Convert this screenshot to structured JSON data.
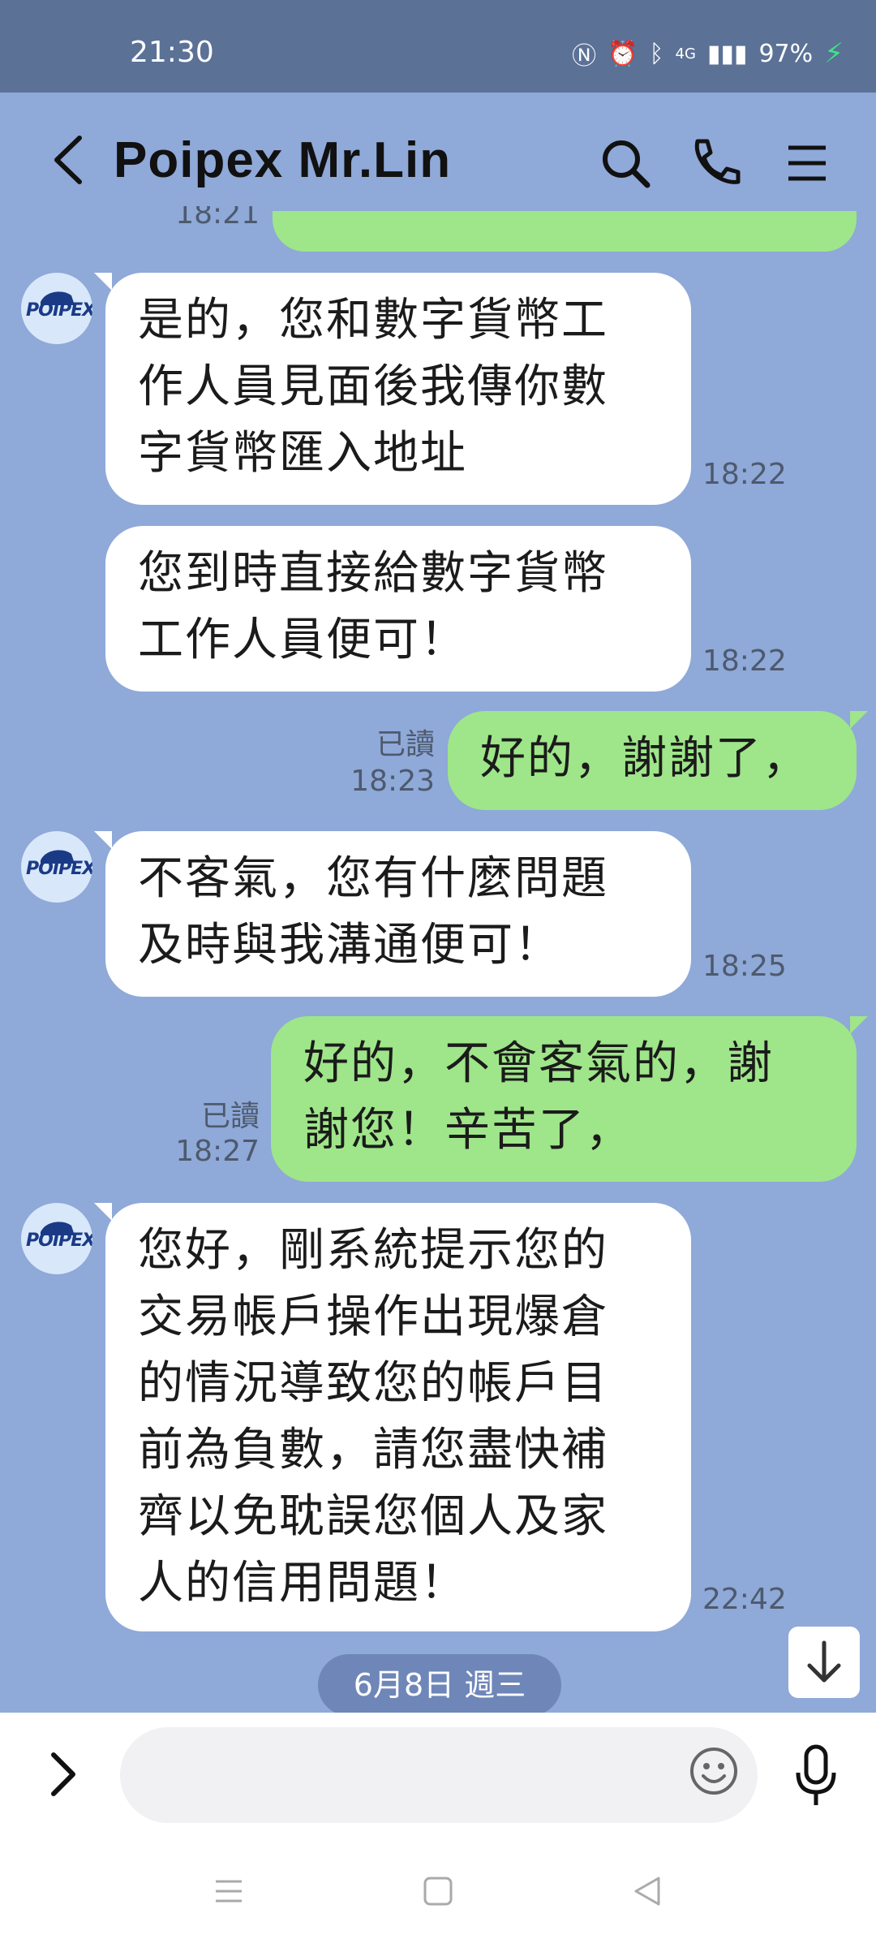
{
  "status": {
    "time": "21:30",
    "signal": "4G",
    "battery": "97%"
  },
  "header": {
    "title": "Poipex  Mr.Lin"
  },
  "avatar_label": "POIPEX",
  "partial_time": "18:21",
  "messages": [
    {
      "side": "left",
      "text": "是的，您和數字貨幣工作人員見面後我傳你數字貨幣匯入地址",
      "lines": [
        "是的，您和數字貨幣工",
        "作人員見面後我傳你數",
        "字貨幣匯入地址"
      ],
      "time": "18:22"
    },
    {
      "side": "left",
      "lines": [
        "您到時直接給數字貨幣",
        "工作人員便可！"
      ],
      "time": "18:22"
    },
    {
      "side": "right",
      "lines": [
        "好的，謝謝了，"
      ],
      "read": "已讀",
      "time": "18:23"
    },
    {
      "side": "left",
      "lines": [
        "不客氣，您有什麼問題",
        "及時與我溝通便可！"
      ],
      "time": "18:25"
    },
    {
      "side": "right",
      "lines": [
        "好的，不會客氣的，謝",
        "謝您！辛苦了，"
      ],
      "read": "已讀",
      "time": "18:27"
    },
    {
      "side": "left",
      "lines": [
        "您好，剛系統提示您的",
        "交易帳戶操作出現爆倉",
        "的情況導致您的帳戶目",
        "前為負數，請您盡快補",
        "齊以免耽誤您個人及家",
        "人的信用問題！"
      ],
      "time": "22:42"
    }
  ],
  "date_divider": "6月8日 週三",
  "colors": {
    "bg": "#8fa9d8",
    "status": "#5b7196",
    "green": "#9fe58a"
  }
}
